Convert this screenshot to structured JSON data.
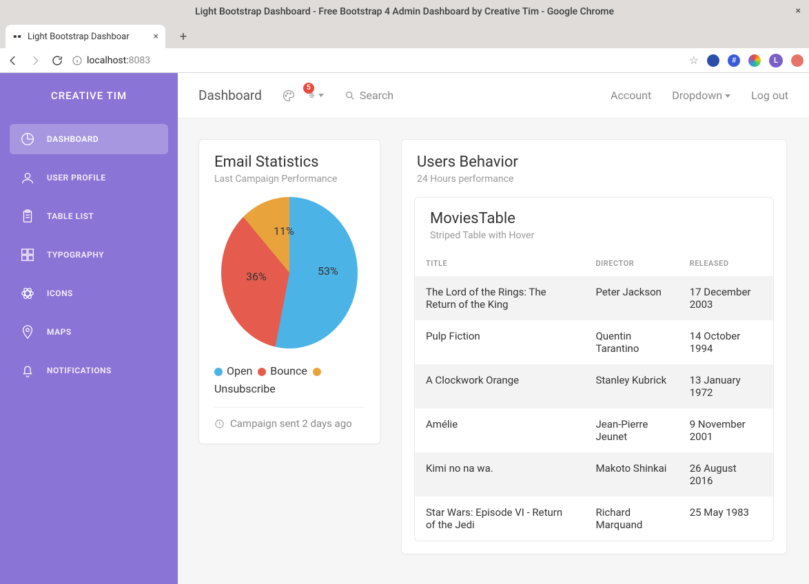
{
  "window": {
    "title": "Light Bootstrap Dashboard - Free Bootstrap 4 Admin Dashboard by Creative Tim - Google Chrome",
    "tab_title": "Light Bootstrap Dashboar",
    "url_host": "localhost:",
    "url_port": "8083"
  },
  "brand": "CREATIVE TIM",
  "sidebar": {
    "items": [
      {
        "label": "DASHBOARD"
      },
      {
        "label": "USER PROFILE"
      },
      {
        "label": "TABLE LIST"
      },
      {
        "label": "TYPOGRAPHY"
      },
      {
        "label": "ICONS"
      },
      {
        "label": "MAPS"
      },
      {
        "label": "NOTIFICATIONS"
      }
    ]
  },
  "topbar": {
    "page_title": "Dashboard",
    "badge": "5",
    "search_placeholder": "Search",
    "right": {
      "account": "Account",
      "dropdown": "Dropdown",
      "logout": "Log out"
    }
  },
  "email_card": {
    "title": "Email Statistics",
    "subtitle": "Last Campaign Performance",
    "legend": {
      "open": "Open",
      "bounce": "Bounce",
      "unsubscribe": "Unsubscribe"
    },
    "footer": "Campaign sent 2 days ago"
  },
  "behavior_card": {
    "title": "Users Behavior",
    "subtitle": "24 Hours performance",
    "table_title": "MoviesTable",
    "table_subtitle": "Striped Table with Hover",
    "columns": {
      "title": "TITLE",
      "director": "DIRECTOR",
      "released": "RELEASED"
    },
    "rows": [
      {
        "title": "The Lord of the Rings: The Return of the King",
        "director": "Peter Jackson",
        "released": "17 December 2003"
      },
      {
        "title": "Pulp Fiction",
        "director": "Quentin Tarantino",
        "released": "14 October 1994"
      },
      {
        "title": "A Clockwork Orange",
        "director": "Stanley Kubrick",
        "released": "13 January 1972"
      },
      {
        "title": "Amélie",
        "director": "Jean-Pierre Jeunet",
        "released": "9 November 2001"
      },
      {
        "title": "Kimi no na wa.",
        "director": "Makoto Shinkai",
        "released": "26 August 2016"
      },
      {
        "title": "Star Wars: Episode VI - Return of the Jedi",
        "director": "Richard Marquand",
        "released": "25 May 1983"
      }
    ]
  },
  "chart_data": {
    "type": "pie",
    "title": "Email Statistics",
    "series": [
      {
        "name": "Open",
        "value": 53,
        "color": "#4bb3e6"
      },
      {
        "name": "Bounce",
        "value": 36,
        "color": "#e55b4d"
      },
      {
        "name": "Unsubscribe",
        "value": 11,
        "color": "#e8a33d"
      }
    ],
    "labels": {
      "open": "53%",
      "bounce": "36%",
      "unsubscribe": "11%"
    }
  },
  "avatar_letter": "L"
}
